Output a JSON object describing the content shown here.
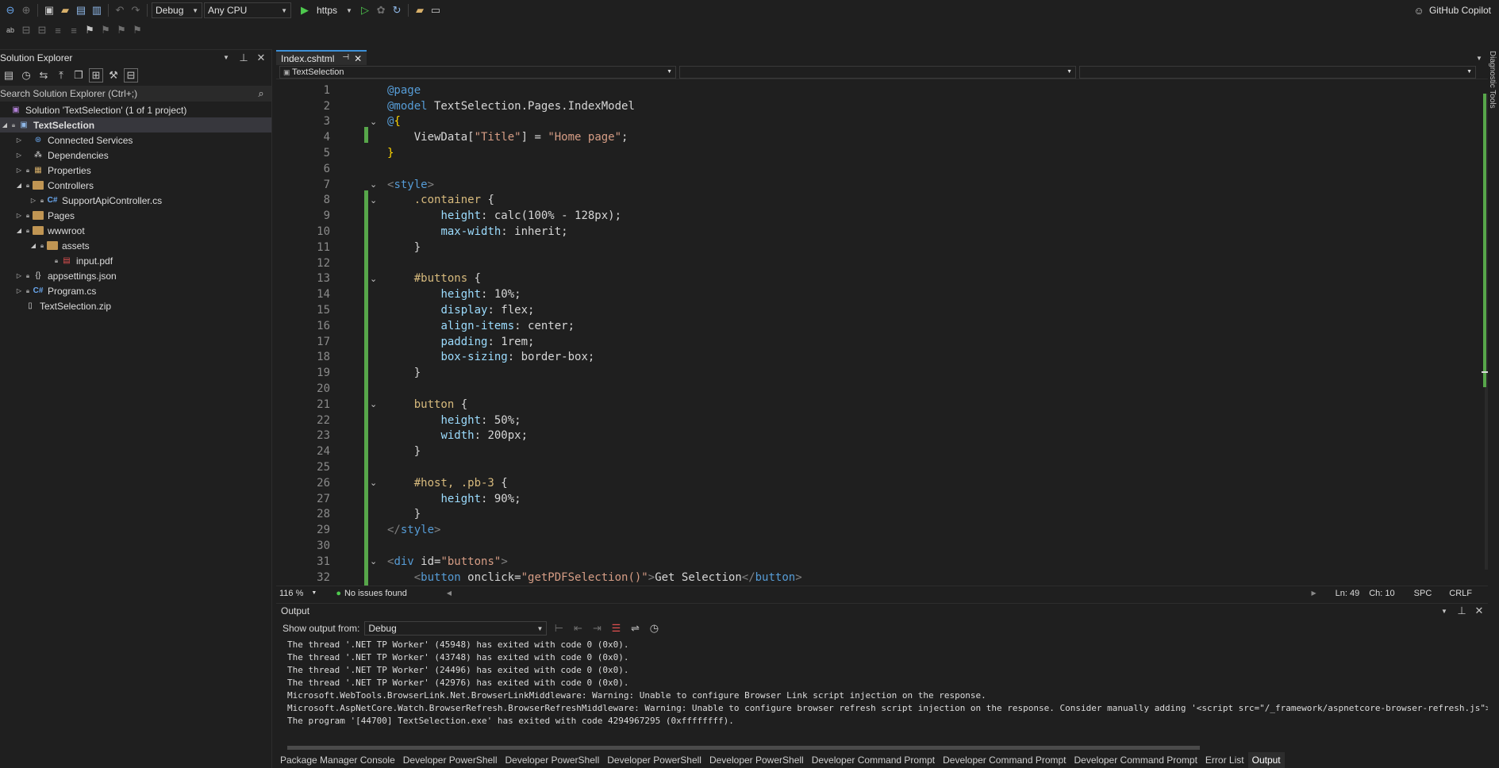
{
  "toolbar": {
    "configuration": "Debug",
    "platform": "Any CPU",
    "run_target": "https",
    "copilot_label": "GitHub Copilot"
  },
  "solution_explorer": {
    "title": "Solution Explorer",
    "search_placeholder": "Search Solution Explorer (Ctrl+;)",
    "items": [
      {
        "label": "Solution 'TextSelection' (1 of 1 project)",
        "icon": "solution-icon"
      },
      {
        "label": "TextSelection",
        "icon": "project-icon"
      },
      {
        "label": "Connected Services",
        "icon": "connected-services-icon"
      },
      {
        "label": "Dependencies",
        "icon": "dependencies-icon"
      },
      {
        "label": "Properties",
        "icon": "properties-icon"
      },
      {
        "label": "Controllers",
        "icon": "folder-icon"
      },
      {
        "label": "SupportApiController.cs",
        "icon": "csharp-file-icon"
      },
      {
        "label": "Pages",
        "icon": "folder-icon"
      },
      {
        "label": "wwwroot",
        "icon": "folder-icon"
      },
      {
        "label": "assets",
        "icon": "folder-icon"
      },
      {
        "label": "input.pdf",
        "icon": "pdf-file-icon"
      },
      {
        "label": "appsettings.json",
        "icon": "json-file-icon"
      },
      {
        "label": "Program.cs",
        "icon": "csharp-file-icon"
      },
      {
        "label": "TextSelection.zip",
        "icon": "file-icon"
      }
    ]
  },
  "editor": {
    "tab_label": "Index.cshtml",
    "nav_context": "TextSelection",
    "zoom": "116 %",
    "issues": "No issues found",
    "position_line": "Ln: 49",
    "position_col": "Ch: 10",
    "whitespace": "SPC",
    "line_ending": "CRLF",
    "lines": [
      {
        "n": "1",
        "text": "@page"
      },
      {
        "n": "2",
        "text": "@model TextSelection.Pages.IndexModel"
      },
      {
        "n": "3",
        "text": "@{"
      },
      {
        "n": "4",
        "text": "    ViewData[\"Title\"] = \"Home page\";"
      },
      {
        "n": "5",
        "text": "}"
      },
      {
        "n": "6",
        "text": ""
      },
      {
        "n": "7",
        "text": "<style>"
      },
      {
        "n": "8",
        "text": "    .container {"
      },
      {
        "n": "9",
        "text": "        height: calc(100% - 128px);"
      },
      {
        "n": "10",
        "text": "        max-width: inherit;"
      },
      {
        "n": "11",
        "text": "    }"
      },
      {
        "n": "12",
        "text": ""
      },
      {
        "n": "13",
        "text": "    #buttons {"
      },
      {
        "n": "14",
        "text": "        height: 10%;"
      },
      {
        "n": "15",
        "text": "        display: flex;"
      },
      {
        "n": "16",
        "text": "        align-items: center;"
      },
      {
        "n": "17",
        "text": "        padding: 1rem;"
      },
      {
        "n": "18",
        "text": "        box-sizing: border-box;"
      },
      {
        "n": "19",
        "text": "    }"
      },
      {
        "n": "20",
        "text": ""
      },
      {
        "n": "21",
        "text": "    button {"
      },
      {
        "n": "22",
        "text": "        height: 50%;"
      },
      {
        "n": "23",
        "text": "        width: 200px;"
      },
      {
        "n": "24",
        "text": "    }"
      },
      {
        "n": "25",
        "text": ""
      },
      {
        "n": "26",
        "text": "    #host, .pb-3 {"
      },
      {
        "n": "27",
        "text": "        height: 90%;"
      },
      {
        "n": "28",
        "text": "    }"
      },
      {
        "n": "29",
        "text": "</style>"
      },
      {
        "n": "30",
        "text": ""
      },
      {
        "n": "31",
        "text": "<div id=\"buttons\">"
      },
      {
        "n": "32",
        "text": "    <button onclick=\"getPDFSelection()\">Get Selection</button>"
      }
    ]
  },
  "output": {
    "title": "Output",
    "show_from_label": "Show output from:",
    "source": "Debug",
    "lines": [
      "The thread '.NET TP Worker' (45948) has exited with code 0 (0x0).",
      "The thread '.NET TP Worker' (43748) has exited with code 0 (0x0).",
      "The thread '.NET TP Worker' (24496) has exited with code 0 (0x0).",
      "The thread '.NET TP Worker' (42976) has exited with code 0 (0x0).",
      "Microsoft.WebTools.BrowserLink.Net.BrowserLinkMiddleware: Warning: Unable to configure Browser Link script injection on the response.",
      "Microsoft.AspNetCore.Watch.BrowserRefresh.BrowserRefreshMiddleware: Warning: Unable to configure browser refresh script injection on the response. Consider manually adding '<script src=\"/_framework/aspnetcore-browser-refresh.js\"></sc",
      "The program '[44700] TextSelection.exe' has exited with code 4294967295 (0xffffffff)."
    ]
  },
  "bottom_tabs": [
    "Package Manager Console",
    "Developer PowerShell",
    "Developer PowerShell",
    "Developer PowerShell",
    "Developer PowerShell",
    "Developer Command Prompt",
    "Developer Command Prompt",
    "Developer Command Prompt",
    "Error List",
    "Output"
  ],
  "right_rail_label": "Diagnostic Tools",
  "colors": {
    "accent": "#3d8fd6",
    "change_bar": "#57a64a",
    "run_green": "#4ec94e",
    "folder": "#c09553"
  }
}
